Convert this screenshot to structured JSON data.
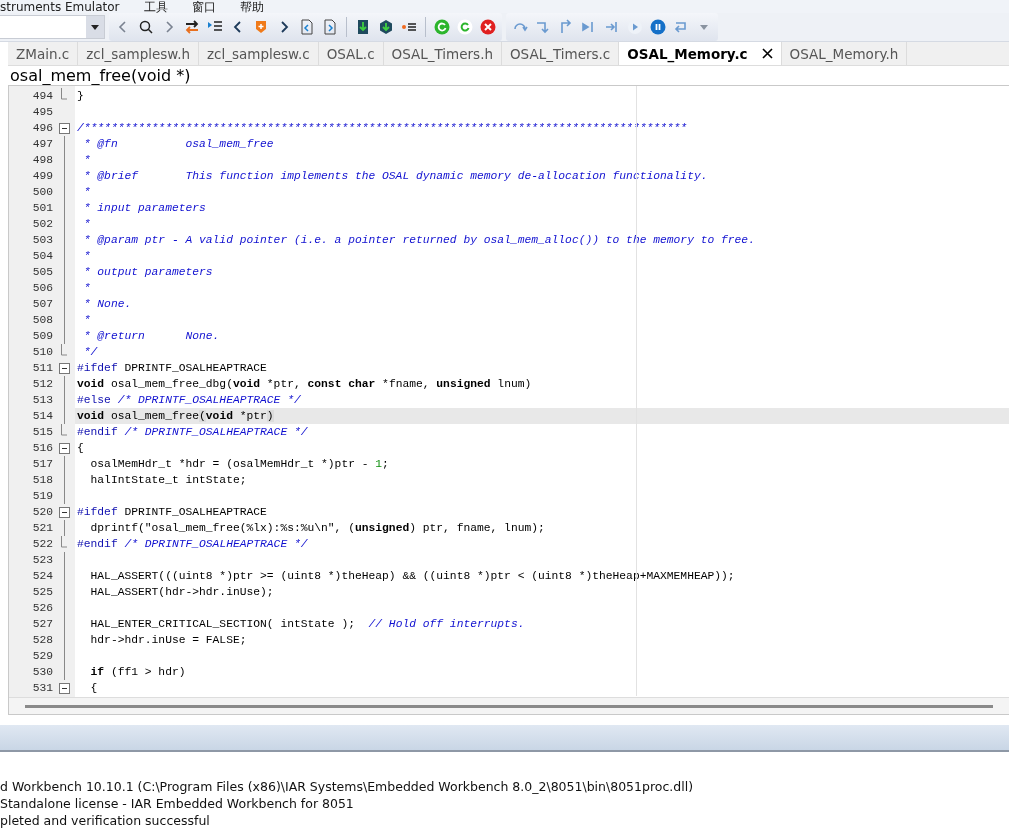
{
  "menu_bar": {
    "items": [
      "struments Emulator",
      "工具",
      "窗口",
      "帮助"
    ]
  },
  "tabs": [
    {
      "label": "ZMain.c",
      "selected": false
    },
    {
      "label": "zcl_samplesw.h",
      "selected": false
    },
    {
      "label": "zcl_samplesw.c",
      "selected": false
    },
    {
      "label": "OSAL.c",
      "selected": false
    },
    {
      "label": "OSAL_Timers.h",
      "selected": false
    },
    {
      "label": "OSAL_Timers.c",
      "selected": false
    },
    {
      "label": "OSAL_Memory.c",
      "selected": true
    },
    {
      "label": "OSAL_Memory.h",
      "selected": false
    }
  ],
  "function_bar": {
    "text": "osal_mem_free(void *)"
  },
  "editor": {
    "lines": [
      {
        "num": "494",
        "kind": "end",
        "current": false,
        "tokens": [
          {
            "kind": "t",
            "text": "}"
          }
        ]
      },
      {
        "num": "495",
        "kind": "plain"
      },
      {
        "num": "496",
        "kind": "open",
        "current": false,
        "tokens": [
          {
            "kind": "c",
            "text": "/*****************************************************************************************"
          }
        ]
      },
      {
        "num": "497",
        "kind": "line",
        "current": false,
        "tokens": [
          {
            "kind": "c",
            "text": " * @fn          osal_mem_free"
          }
        ]
      },
      {
        "num": "498",
        "kind": "line",
        "current": false,
        "tokens": [
          {
            "kind": "c",
            "text": " *"
          }
        ]
      },
      {
        "num": "499",
        "kind": "line",
        "current": false,
        "tokens": [
          {
            "kind": "c",
            "text": " * @brief       This function implements the OSAL dynamic memory de-allocation functionality."
          }
        ]
      },
      {
        "num": "500",
        "kind": "line",
        "current": false,
        "tokens": [
          {
            "kind": "c",
            "text": " *"
          }
        ]
      },
      {
        "num": "501",
        "kind": "line",
        "current": false,
        "tokens": [
          {
            "kind": "c",
            "text": " * input parameters"
          }
        ]
      },
      {
        "num": "502",
        "kind": "line",
        "current": false,
        "tokens": [
          {
            "kind": "c",
            "text": " *"
          }
        ]
      },
      {
        "num": "503",
        "kind": "line",
        "current": false,
        "tokens": [
          {
            "kind": "c",
            "text": " * @param ptr - A valid pointer (i.e. a pointer returned by osal_mem_alloc()) to the memory to free."
          }
        ]
      },
      {
        "num": "504",
        "kind": "line",
        "current": false,
        "tokens": [
          {
            "kind": "c",
            "text": " *"
          }
        ]
      },
      {
        "num": "505",
        "kind": "line",
        "current": false,
        "tokens": [
          {
            "kind": "c",
            "text": " * output parameters"
          }
        ]
      },
      {
        "num": "506",
        "kind": "line",
        "current": false,
        "tokens": [
          {
            "kind": "c",
            "text": " *"
          }
        ]
      },
      {
        "num": "507",
        "kind": "line",
        "current": false,
        "tokens": [
          {
            "kind": "c",
            "text": " * None."
          }
        ]
      },
      {
        "num": "508",
        "kind": "line",
        "current": false,
        "tokens": [
          {
            "kind": "c",
            "text": " *"
          }
        ]
      },
      {
        "num": "509",
        "kind": "line",
        "current": false,
        "tokens": [
          {
            "kind": "c",
            "text": " * @return      None."
          }
        ]
      },
      {
        "num": "510",
        "kind": "end",
        "current": false,
        "tokens": [
          {
            "kind": "c",
            "text": " */"
          }
        ]
      },
      {
        "num": "511",
        "kind": "open",
        "current": false,
        "tokens": [
          {
            "kind": "p",
            "text": "#ifdef"
          },
          {
            "kind": "t",
            "text": " DPRINTF_OSALHEAPTRACE"
          }
        ]
      },
      {
        "num": "512",
        "kind": "line",
        "current": false,
        "tokens": [
          {
            "kind": "k",
            "text": "void"
          },
          {
            "kind": "t",
            "text": " osal_mem_free_dbg("
          },
          {
            "kind": "k",
            "text": "void"
          },
          {
            "kind": "t",
            "text": " *ptr, "
          },
          {
            "kind": "k",
            "text": "const char"
          },
          {
            "kind": "t",
            "text": " *fname, "
          },
          {
            "kind": "k",
            "text": "unsigned"
          },
          {
            "kind": "t",
            "text": " lnum)"
          }
        ]
      },
      {
        "num": "513",
        "kind": "line",
        "current": false,
        "tokens": [
          {
            "kind": "p",
            "text": "#else"
          },
          {
            "kind": "c",
            "text": " /* DPRINTF_OSALHEAPTRACE */"
          }
        ]
      },
      {
        "num": "514",
        "kind": "line",
        "current": true,
        "tokens": [
          {
            "kind": "k",
            "text": "void"
          },
          {
            "kind": "t",
            "text": " osal_mem_free"
          },
          {
            "kind": "m",
            "text": "("
          },
          {
            "kind": "k",
            "text": "void"
          },
          {
            "kind": "t",
            "text": " *ptr"
          },
          {
            "kind": "m",
            "text": ")"
          }
        ]
      },
      {
        "num": "515",
        "kind": "end",
        "current": false,
        "tokens": [
          {
            "kind": "p",
            "text": "#endif"
          },
          {
            "kind": "c",
            "text": " /* DPRINTF_OSALHEAPTRACE */"
          }
        ]
      },
      {
        "num": "516",
        "kind": "open",
        "current": false,
        "tokens": [
          {
            "kind": "t",
            "text": "{"
          }
        ]
      },
      {
        "num": "517",
        "kind": "line",
        "current": false,
        "tokens": [
          {
            "kind": "t",
            "text": "  osalMemHdr_t *hdr = (osalMemHdr_t *)ptr - "
          },
          {
            "kind": "n",
            "text": "1"
          },
          {
            "kind": "t",
            "text": ";"
          }
        ]
      },
      {
        "num": "518",
        "kind": "line",
        "current": false,
        "tokens": [
          {
            "kind": "t",
            "text": "  halIntState_t intState;"
          }
        ]
      },
      {
        "num": "519",
        "kind": "line"
      },
      {
        "num": "520",
        "kind": "open",
        "current": false,
        "tokens": [
          {
            "kind": "p",
            "text": "#ifdef"
          },
          {
            "kind": "t",
            "text": " DPRINTF_OSALHEAPTRACE"
          }
        ]
      },
      {
        "num": "521",
        "kind": "line",
        "current": false,
        "tokens": [
          {
            "kind": "t",
            "text": "  dprintf(\"osal_mem_free(%lx):%s:%u\\n\", ("
          },
          {
            "kind": "k",
            "text": "unsigned"
          },
          {
            "kind": "t",
            "text": ") ptr, fname, lnum);"
          }
        ]
      },
      {
        "num": "522",
        "kind": "end",
        "current": false,
        "tokens": [
          {
            "kind": "p",
            "text": "#endif"
          },
          {
            "kind": "c",
            "text": " /* DPRINTF_OSALHEAPTRACE */"
          }
        ]
      },
      {
        "num": "523",
        "kind": "line"
      },
      {
        "num": "524",
        "kind": "line",
        "current": false,
        "tokens": [
          {
            "kind": "t",
            "text": "  HAL_ASSERT(((uint8 *)ptr >= (uint8 *)theHeap) && ((uint8 *)ptr < (uint8 *)theHeap+MAXMEMHEAP));"
          }
        ]
      },
      {
        "num": "525",
        "kind": "line",
        "current": false,
        "tokens": [
          {
            "kind": "t",
            "text": "  HAL_ASSERT(hdr->hdr.inUse);"
          }
        ]
      },
      {
        "num": "526",
        "kind": "line"
      },
      {
        "num": "527",
        "kind": "line",
        "current": false,
        "tokens": [
          {
            "kind": "t",
            "text": "  HAL_ENTER_CRITICAL_SECTION( intState );  "
          },
          {
            "kind": "c",
            "text": "// Hold off interrupts."
          }
        ]
      },
      {
        "num": "528",
        "kind": "line",
        "current": false,
        "tokens": [
          {
            "kind": "t",
            "text": "  hdr->hdr.inUse = FALSE;"
          }
        ]
      },
      {
        "num": "529",
        "kind": "line"
      },
      {
        "num": "530",
        "kind": "line",
        "current": false,
        "tokens": [
          {
            "kind": "k",
            "text": "  if"
          },
          {
            "kind": "t",
            "text": " (ff1 > hdr)"
          }
        ]
      },
      {
        "num": "531",
        "kind": "open",
        "current": false,
        "tokens": [
          {
            "kind": "t",
            "text": "  {"
          }
        ]
      }
    ]
  },
  "output": {
    "lines": [
      "d Workbench 10.10.1 (C:\\Program Files (x86)\\IAR Systems\\Embedded Workbench 8.0_2\\8051\\bin\\8051proc.dll)",
      " Standalone license - IAR Embedded Workbench for 8051",
      "pleted and verification successful"
    ]
  }
}
